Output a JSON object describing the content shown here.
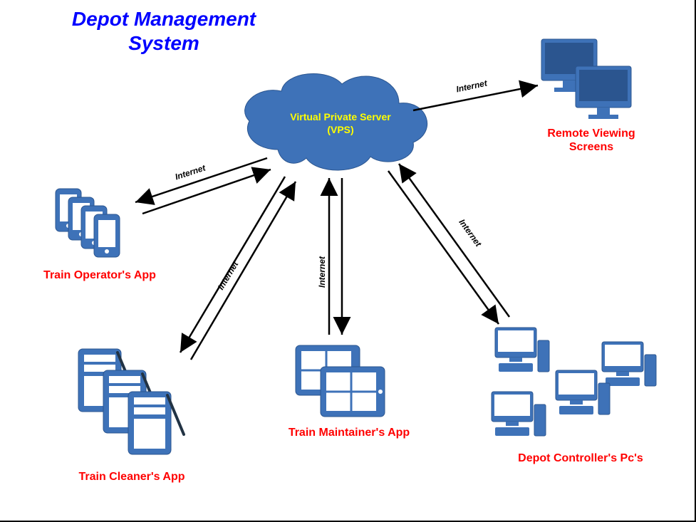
{
  "title": {
    "line1": "Depot Management",
    "line2": "System"
  },
  "center": {
    "label_line1": "Virtual Private Server",
    "label_line2": "(VPS)"
  },
  "nodes": {
    "train_operator": {
      "label": "Train Operator's App"
    },
    "train_cleaner": {
      "label": "Train Cleaner's App"
    },
    "train_maintainer": {
      "label": "Train Maintainer's App"
    },
    "depot_controller": {
      "label": "Depot Controller's Pc's"
    },
    "remote_viewing": {
      "label_line1": "Remote Viewing",
      "label_line2": "Screens"
    }
  },
  "edges": {
    "to_operator": {
      "label": "Internet"
    },
    "to_cleaner": {
      "label": "Internet"
    },
    "to_maintainer": {
      "label": "Internet"
    },
    "to_controller": {
      "label": "Internet"
    },
    "to_remote": {
      "label": "Internet"
    }
  },
  "colors": {
    "title": "#0000FF",
    "node_label": "#FF0000",
    "cloud_fill": "#3E72B8",
    "cloud_text": "#FFFF00",
    "icon_fill": "#3E72B8",
    "arrow": "#000000"
  }
}
